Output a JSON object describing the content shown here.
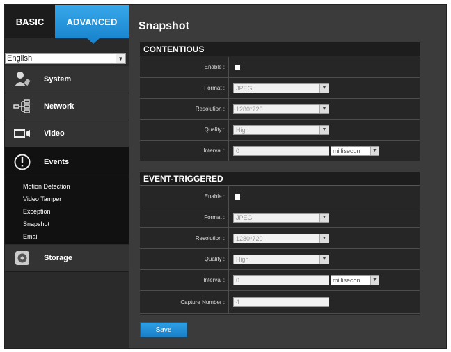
{
  "tabs": {
    "basic": "BASIC",
    "advanced": "ADVANCED"
  },
  "language": {
    "selected": "English"
  },
  "menu": {
    "system": "System",
    "network": "Network",
    "video": "Video",
    "events": "Events",
    "storage": "Storage"
  },
  "events_submenu": [
    "Motion Detection",
    "Video Tamper",
    "Exception",
    "Snapshot",
    "Email"
  ],
  "page": {
    "title": "Snapshot"
  },
  "continuous": {
    "heading": "CONTENTIOUS",
    "enable_label": "Enable :",
    "format_label": "Format :",
    "format_value": "JPEG",
    "resolution_label": "Resolution :",
    "resolution_value": "1280*720",
    "quality_label": "Quality :",
    "quality_value": "High",
    "interval_label": "Interval :",
    "interval_value": "0",
    "interval_unit": "millisecon"
  },
  "event_triggered": {
    "heading": "EVENT-TRIGGERED",
    "enable_label": "Enable :",
    "format_label": "Format :",
    "format_value": "JPEG",
    "resolution_label": "Resolution :",
    "resolution_value": "1280*720",
    "quality_label": "Quality :",
    "quality_value": "High",
    "interval_label": "Interval :",
    "interval_value": "0",
    "interval_unit": "millisecon",
    "capture_label": "Capture Number :",
    "capture_value": "4"
  },
  "save_label": "Save",
  "colors": {
    "accent": "#1a86cf",
    "background": "#3b3b3b",
    "sidebar": "#2a2a2a"
  }
}
